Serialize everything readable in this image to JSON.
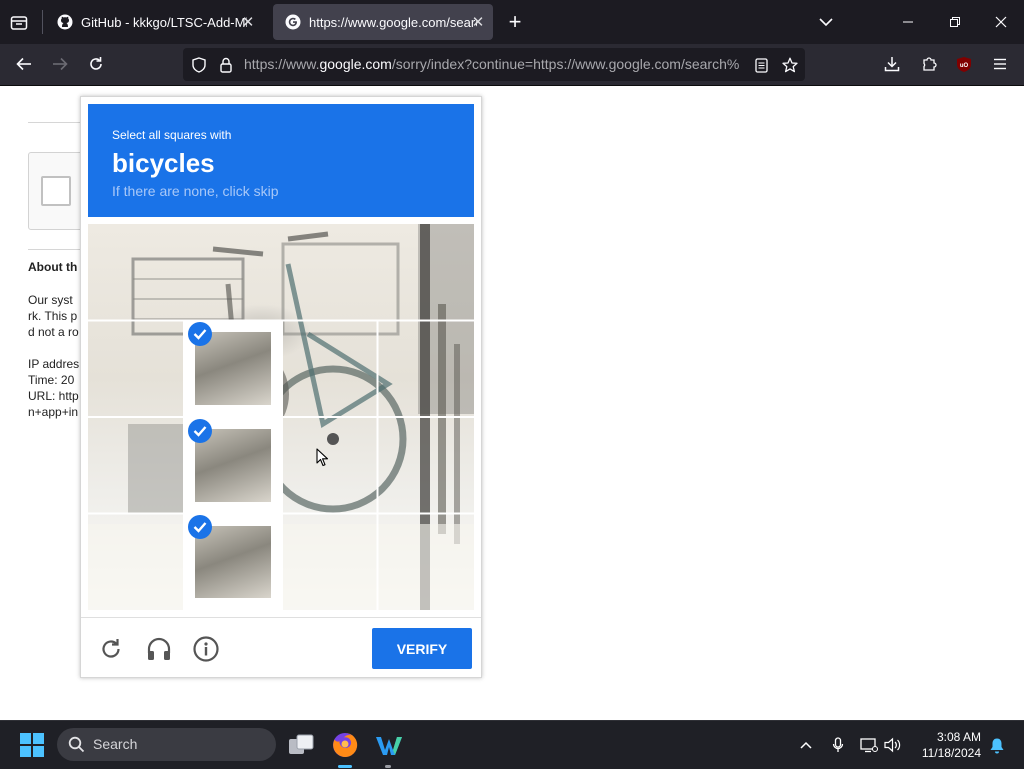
{
  "browser": {
    "tabs": [
      {
        "title": "GitHub - kkkgo/LTSC-Add-Micr",
        "icon": "github-icon",
        "active": false
      },
      {
        "title": "https://www.google.com/search",
        "icon": "google-icon",
        "active": true
      }
    ],
    "url": {
      "prefix": "https://www.",
      "domain": "google.com",
      "suffix": "/sorry/index?continue=https://www.google.com/search%"
    }
  },
  "page": {
    "about_heading": "About th",
    "lines": [
      "Our syst",
      "rk. This p",
      "d not a ro",
      "IP addres",
      "Time: 20",
      "URL: http",
      "n+app+in"
    ]
  },
  "captcha": {
    "instruction": "Select all squares with",
    "target": "bicycles",
    "hint": "If there are none, click skip",
    "verify_label": "VERIFY",
    "selected_tiles": [
      [
        1,
        0
      ],
      [
        2,
        0
      ],
      [
        3,
        0
      ]
    ]
  },
  "taskbar": {
    "search_placeholder": "Search",
    "time": "3:08 AM",
    "date": "11/18/2024"
  },
  "colors": {
    "captcha_blue": "#1a73e8",
    "tab_active": "#42414d",
    "chrome_bg": "#1c1b22"
  }
}
